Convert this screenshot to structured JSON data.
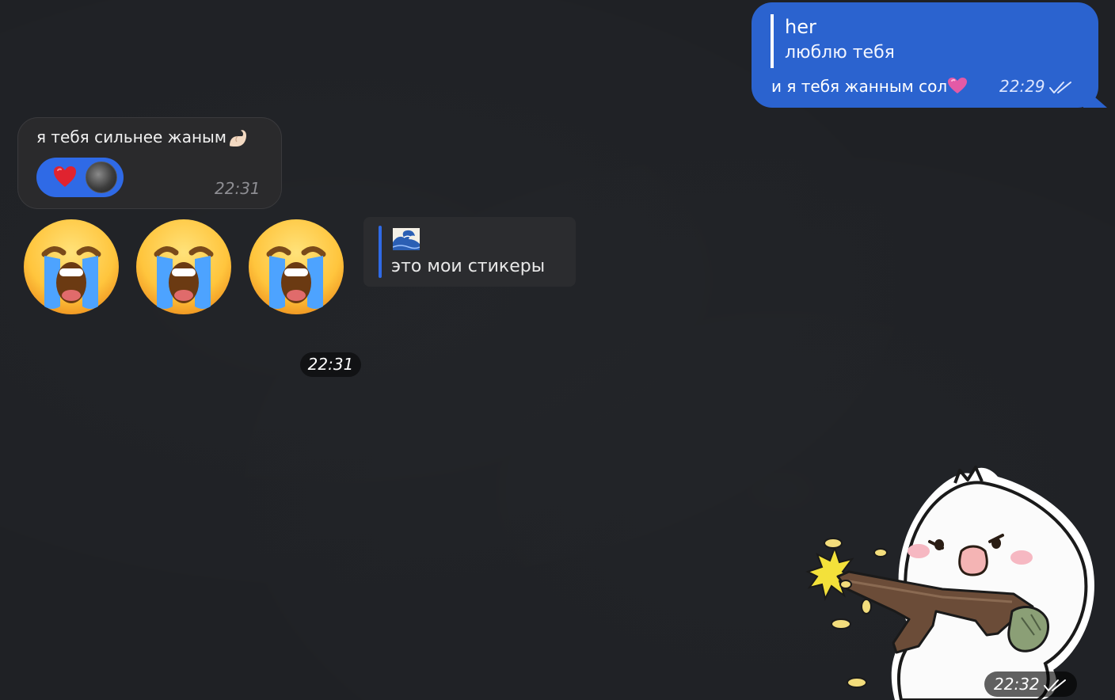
{
  "outgoing": {
    "reply_name": "her",
    "reply_text": "люблю тебя",
    "text": "и я тебя жанным сол",
    "heart_emoji": "pink-heart",
    "time": "22:29",
    "status": "read-double-check"
  },
  "incoming": {
    "text": "я тебя сильнее жаным",
    "hand_emoji": "pinching-hand",
    "reaction_emoji": "red-heart",
    "time": "22:31"
  },
  "stickers": {
    "emojis": [
      "loudly-crying-face",
      "loudly-crying-face",
      "loudly-crying-face"
    ],
    "time": "22:31"
  },
  "quote": {
    "icon": "wave-icon",
    "text": "это мои стикеры"
  },
  "shooter_sticker": {
    "time": "22:32",
    "status": "read-double-check"
  },
  "colors": {
    "background": "#1f2125",
    "outgoing_bubble": "#2b63cf",
    "incoming_bubble": "#2a2a2c",
    "accent": "#2f6ae6"
  }
}
